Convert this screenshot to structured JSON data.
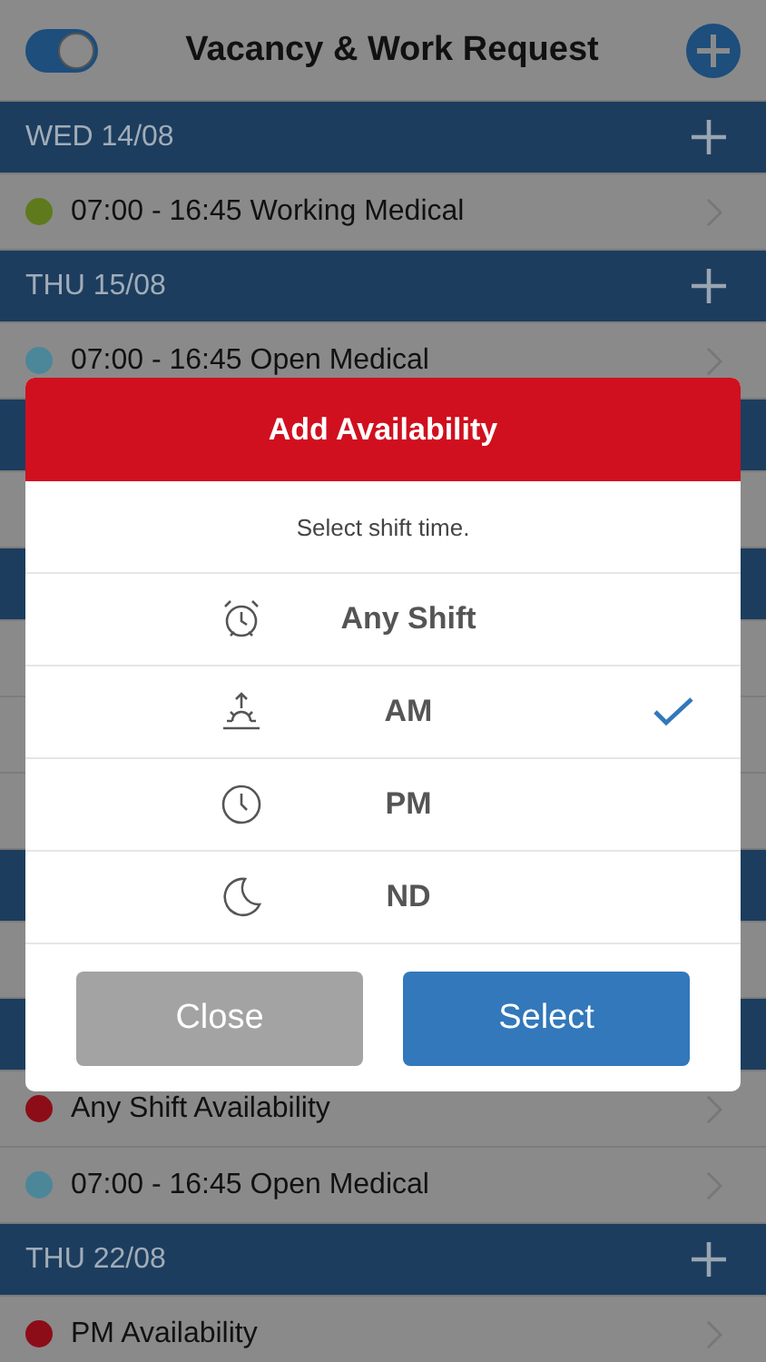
{
  "nav": {
    "toggle": {
      "on": true
    },
    "title": "Vacancy & Work Request"
  },
  "list_top": [
    {
      "kind": "day",
      "label": "WED 14/08"
    },
    {
      "kind": "entry",
      "text": "07:00 - 16:45 Working Medical",
      "color": "#5f7a1c"
    },
    {
      "kind": "day",
      "label": "THU 15/08"
    },
    {
      "kind": "entry",
      "text": "07:00 - 16:45 Open Medical",
      "color": "#4b8799"
    }
  ],
  "list_bottom": [
    {
      "kind": "entry",
      "text": "Any Shift Availability",
      "color": "#8c0d18"
    },
    {
      "kind": "entry",
      "text": "07:00 - 16:45 Open Medical",
      "color": "#4b8799"
    },
    {
      "kind": "day",
      "label": "THU 22/08"
    },
    {
      "kind": "entry",
      "text": "PM Availability",
      "color": "#8c0d18"
    }
  ],
  "dialog": {
    "title": "Add Availability",
    "subtitle": "Select shift time.",
    "options": [
      {
        "kind": "alarm",
        "label": "Any Shift",
        "selected": false
      },
      {
        "kind": "sunrise",
        "label": "AM",
        "selected": true
      },
      {
        "kind": "clock",
        "label": "PM",
        "selected": false
      },
      {
        "kind": "moon",
        "label": "ND",
        "selected": false
      }
    ],
    "buttons": [
      {
        "kind": "secondary",
        "label": "Close"
      },
      {
        "kind": "primary",
        "label": "Select"
      }
    ]
  }
}
